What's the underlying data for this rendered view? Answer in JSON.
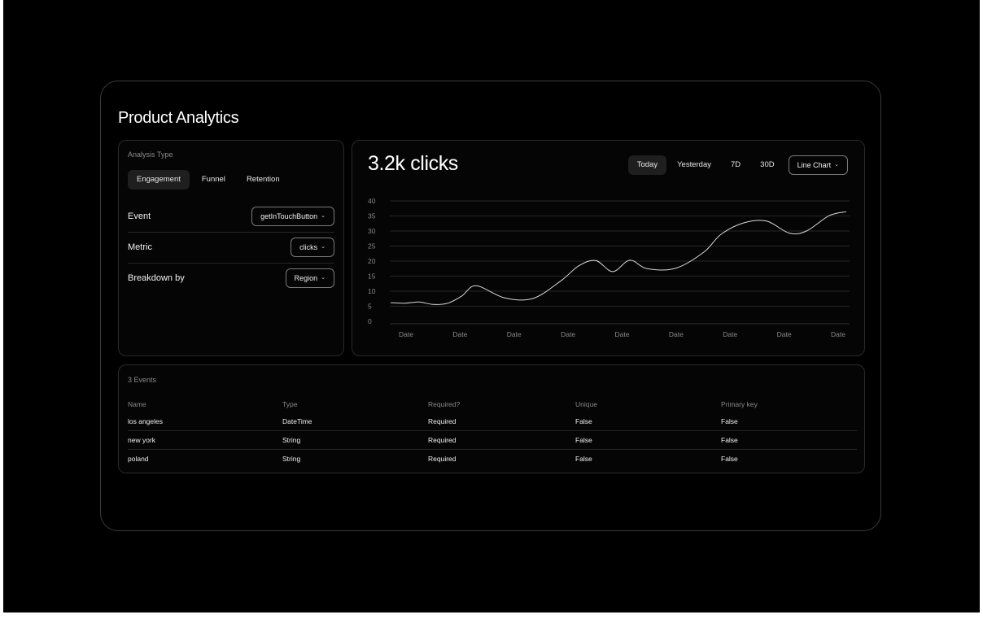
{
  "title": "Product Analytics",
  "analysis": {
    "label": "Analysis Type",
    "tabs": [
      {
        "label": "Engagement",
        "active": true
      },
      {
        "label": "Funnel",
        "active": false
      },
      {
        "label": "Retention",
        "active": false
      }
    ],
    "fields": [
      {
        "label": "Event",
        "value": "getInTouchButton"
      },
      {
        "label": "Metric",
        "value": "clicks"
      },
      {
        "label": "Breakdown by",
        "value": "Region"
      }
    ]
  },
  "chart_panel": {
    "headline": "3.2k clicks",
    "ranges": [
      {
        "label": "Today",
        "active": true
      },
      {
        "label": "Yesterday",
        "active": false
      },
      {
        "label": "7D",
        "active": false
      },
      {
        "label": "30D",
        "active": false
      }
    ],
    "chart_type_label": "Line Chart"
  },
  "chart_data": {
    "type": "line",
    "x": [
      "Date",
      "Date",
      "Date",
      "Date",
      "Date",
      "Date",
      "Date",
      "Date",
      "Date"
    ],
    "ylim": [
      0,
      40
    ],
    "yticks": [
      0,
      5,
      10,
      15,
      20,
      25,
      30,
      35,
      40
    ],
    "grid": true,
    "title": "",
    "xlabel": "",
    "ylabel": "",
    "series": [
      {
        "x": [
          0,
          0.25,
          0.5,
          0.75,
          1,
          1.25,
          1.5,
          2,
          2.5,
          3,
          3.3,
          3.6,
          3.9,
          4.2,
          4.5,
          5,
          5.5,
          5.8,
          6.2,
          6.6,
          7,
          7.3,
          7.7,
          8
        ],
        "values": [
          6.2,
          6.0,
          6.4,
          5.6,
          6.0,
          8.4,
          11.8,
          7.8,
          7.6,
          13.6,
          18.4,
          20.2,
          16.5,
          20.3,
          17.5,
          17.6,
          23.0,
          28.9,
          32.7,
          33.3,
          29.3,
          30.0,
          35.1,
          36.4
        ]
      }
    ],
    "stroke_color": "#d9d9d9"
  },
  "events_table": {
    "count_label": "3 Events",
    "columns": [
      "Name",
      "Type",
      "Required?",
      "Unique",
      "Primary key"
    ],
    "rows": [
      [
        "los angeles",
        "DateTime",
        "Required",
        "False",
        "False"
      ],
      [
        "new york",
        "String",
        "Required",
        "False",
        "False"
      ],
      [
        "poland",
        "String",
        "Required",
        "False",
        "False"
      ]
    ]
  }
}
